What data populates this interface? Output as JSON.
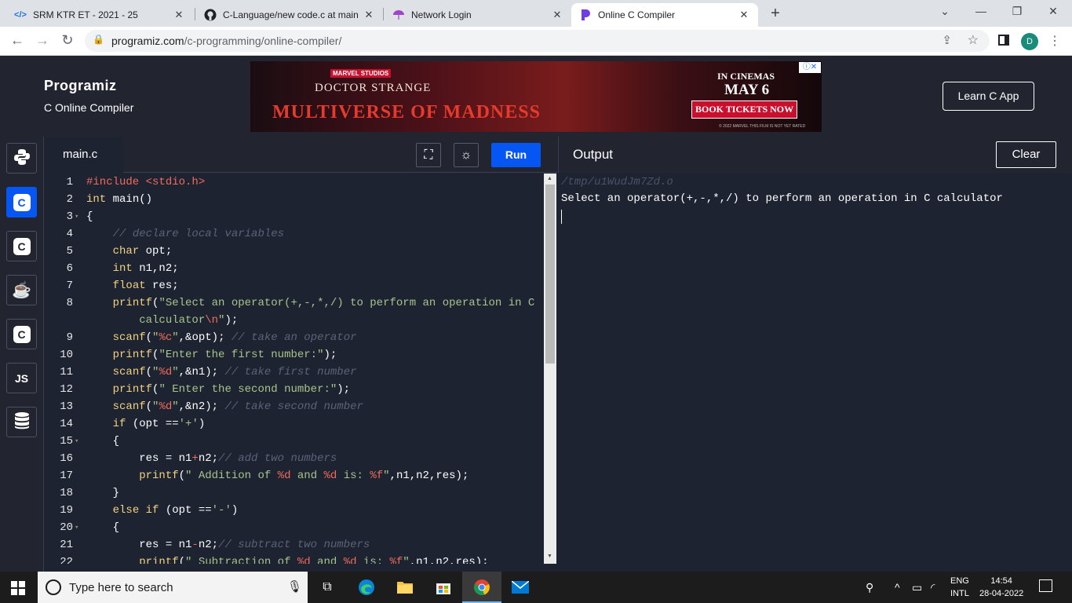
{
  "browser": {
    "tabs": [
      {
        "title": "SRM KTR ET - 2021 - 25",
        "icon": "code-favicon"
      },
      {
        "title": "C-Language/new code.c at main",
        "icon": "github-icon"
      },
      {
        "title": "Network Login",
        "icon": "umbrella-icon"
      },
      {
        "title": "Online C Compiler",
        "icon": "programiz-icon"
      }
    ],
    "url_host": "programiz.com",
    "url_path": "/c-programming/online-compiler/",
    "profile_initial": "D"
  },
  "header": {
    "logo": "Programiz",
    "subtitle": "C Online Compiler",
    "learn_button": "Learn C App"
  },
  "ad": {
    "studio": "MARVEL STUDIOS",
    "title_top": "DOCTOR STRANGE",
    "title_bottom": "MULTIVERSE OF MADNESS",
    "in_cinemas": "IN CINEMAS",
    "date": "MAY 6",
    "cta": "BOOK TICKETS NOW",
    "copyright": "© 2022 MARVEL   THIS FILM IS NOT YET RATED"
  },
  "languages": [
    {
      "name": "python",
      "label": "🐍"
    },
    {
      "name": "c",
      "label": "C"
    },
    {
      "name": "cpp",
      "label": "C"
    },
    {
      "name": "java",
      "label": "☕"
    },
    {
      "name": "csharp",
      "label": "C"
    },
    {
      "name": "javascript",
      "label": "JS"
    },
    {
      "name": "sql",
      "label": "🛢"
    }
  ],
  "editor": {
    "filename": "main.c",
    "run_label": "Run"
  },
  "code_lines": [
    {
      "n": "1",
      "fold": "",
      "tokens": [
        [
          "e",
          "#include "
        ],
        [
          "e",
          "<stdio.h>"
        ]
      ]
    },
    {
      "n": "2",
      "fold": "",
      "tokens": [
        [
          "k",
          "int "
        ],
        [
          "i",
          "main()"
        ]
      ]
    },
    {
      "n": "3",
      "fold": "▾",
      "tokens": [
        [
          "i",
          "{"
        ]
      ]
    },
    {
      "n": "4",
      "fold": "",
      "tokens": [
        [
          "i",
          "    "
        ],
        [
          "c",
          "// declare local variables"
        ]
      ]
    },
    {
      "n": "5",
      "fold": "",
      "tokens": [
        [
          "i",
          "    "
        ],
        [
          "k",
          "char "
        ],
        [
          "i",
          "opt;"
        ]
      ]
    },
    {
      "n": "6",
      "fold": "",
      "tokens": [
        [
          "i",
          "    "
        ],
        [
          "k",
          "int "
        ],
        [
          "i",
          "n1,n2;"
        ]
      ]
    },
    {
      "n": "7",
      "fold": "",
      "tokens": [
        [
          "i",
          "    "
        ],
        [
          "k",
          "float "
        ],
        [
          "i",
          "res;"
        ]
      ]
    },
    {
      "n": "8",
      "fold": "",
      "tokens": [
        [
          "i",
          "    "
        ],
        [
          "k",
          "printf"
        ],
        [
          "i",
          "("
        ],
        [
          "s",
          "\"Select an operator(+,-,*,/) to perform an operation in C"
        ]
      ]
    },
    {
      "n": "",
      "fold": "",
      "tokens": [
        [
          "i",
          "        "
        ],
        [
          "s",
          "calculator"
        ],
        [
          "e",
          "\\n"
        ],
        [
          "s",
          "\""
        ],
        [
          "i",
          ");"
        ]
      ]
    },
    {
      "n": "9",
      "fold": "",
      "tokens": [
        [
          "i",
          "    "
        ],
        [
          "k",
          "scanf"
        ],
        [
          "i",
          "("
        ],
        [
          "s",
          "\""
        ],
        [
          "e",
          "%c"
        ],
        [
          "s",
          "\""
        ],
        [
          "i",
          ",&opt); "
        ],
        [
          "c",
          "// take an operator"
        ]
      ]
    },
    {
      "n": "10",
      "fold": "",
      "tokens": [
        [
          "i",
          "    "
        ],
        [
          "k",
          "printf"
        ],
        [
          "i",
          "("
        ],
        [
          "s",
          "\"Enter the first number:\""
        ],
        [
          "i",
          ");"
        ]
      ]
    },
    {
      "n": "11",
      "fold": "",
      "tokens": [
        [
          "i",
          "    "
        ],
        [
          "k",
          "scanf"
        ],
        [
          "i",
          "("
        ],
        [
          "s",
          "\""
        ],
        [
          "e",
          "%d"
        ],
        [
          "s",
          "\""
        ],
        [
          "i",
          ",&n1); "
        ],
        [
          "c",
          "// take first number"
        ]
      ]
    },
    {
      "n": "12",
      "fold": "",
      "tokens": [
        [
          "i",
          "    "
        ],
        [
          "k",
          "printf"
        ],
        [
          "i",
          "("
        ],
        [
          "s",
          "\" Enter the second number:\""
        ],
        [
          "i",
          ");"
        ]
      ]
    },
    {
      "n": "13",
      "fold": "",
      "tokens": [
        [
          "i",
          "    "
        ],
        [
          "k",
          "scanf"
        ],
        [
          "i",
          "("
        ],
        [
          "s",
          "\""
        ],
        [
          "e",
          "%d"
        ],
        [
          "s",
          "\""
        ],
        [
          "i",
          ",&n2); "
        ],
        [
          "c",
          "// take second number"
        ]
      ]
    },
    {
      "n": "14",
      "fold": "",
      "tokens": [
        [
          "i",
          "    "
        ],
        [
          "k",
          "if "
        ],
        [
          "i",
          "(opt =="
        ],
        [
          "s",
          "'+'"
        ],
        [
          "i",
          ")"
        ]
      ]
    },
    {
      "n": "15",
      "fold": "▾",
      "tokens": [
        [
          "i",
          "    {"
        ]
      ]
    },
    {
      "n": "16",
      "fold": "",
      "tokens": [
        [
          "i",
          "        res = n1"
        ],
        [
          "e",
          "+"
        ],
        [
          "i",
          "n2;"
        ],
        [
          "c",
          "// add two numbers"
        ]
      ]
    },
    {
      "n": "17",
      "fold": "",
      "tokens": [
        [
          "i",
          "        "
        ],
        [
          "k",
          "printf"
        ],
        [
          "i",
          "("
        ],
        [
          "s",
          "\" Addition of "
        ],
        [
          "e",
          "%d"
        ],
        [
          "s",
          " and "
        ],
        [
          "e",
          "%d"
        ],
        [
          "s",
          " is: "
        ],
        [
          "e",
          "%f"
        ],
        [
          "s",
          "\""
        ],
        [
          "i",
          ",n1,n2,res);"
        ]
      ]
    },
    {
      "n": "18",
      "fold": "",
      "tokens": [
        [
          "i",
          "    }"
        ]
      ]
    },
    {
      "n": "19",
      "fold": "",
      "tokens": [
        [
          "i",
          "    "
        ],
        [
          "k",
          "else if "
        ],
        [
          "i",
          "(opt =="
        ],
        [
          "s",
          "'-'"
        ],
        [
          "i",
          ")"
        ]
      ]
    },
    {
      "n": "20",
      "fold": "▾",
      "tokens": [
        [
          "i",
          "    {"
        ]
      ]
    },
    {
      "n": "21",
      "fold": "",
      "tokens": [
        [
          "i",
          "        res = n1"
        ],
        [
          "e",
          "-"
        ],
        [
          "i",
          "n2;"
        ],
        [
          "c",
          "// subtract two numbers"
        ]
      ]
    },
    {
      "n": "22",
      "fold": "",
      "tokens": [
        [
          "i",
          "        "
        ],
        [
          "k",
          "printf"
        ],
        [
          "i",
          "("
        ],
        [
          "s",
          "\" Subtraction of "
        ],
        [
          "e",
          "%d"
        ],
        [
          "s",
          " and "
        ],
        [
          "e",
          "%d"
        ],
        [
          "s",
          " is: "
        ],
        [
          "e",
          "%f"
        ],
        [
          "s",
          "\""
        ],
        [
          "i",
          ",n1,n2,res);"
        ]
      ]
    }
  ],
  "output": {
    "title": "Output",
    "clear_label": "Clear",
    "path": "/tmp/u1WudJm7Zd.o",
    "text": "Select an operator(+,-,*,/) to perform an operation in C calculator"
  },
  "taskbar": {
    "search_placeholder": "Type here to search",
    "lang_top": "ENG",
    "lang_bottom": "INTL",
    "time": "14:54",
    "date": "28-04-2022"
  }
}
